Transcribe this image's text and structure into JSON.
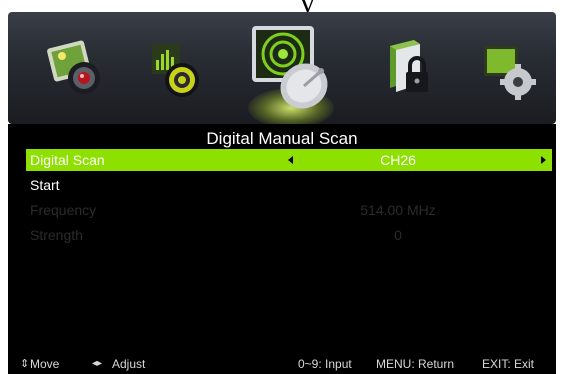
{
  "menu": {
    "title": "Digital Manual Scan",
    "rows": [
      {
        "label": "Digital Scan",
        "value": "CH26",
        "selected": true
      },
      {
        "label": "Start",
        "value": ""
      },
      {
        "label": "Frequency",
        "value": "514.00 MHz",
        "disabled": true
      },
      {
        "label": "Strength",
        "value": "0",
        "disabled": true
      }
    ]
  },
  "top_icons": [
    {
      "name": "picture-icon",
      "selected": false
    },
    {
      "name": "sound-icon",
      "selected": false
    },
    {
      "name": "channel-icon",
      "selected": true
    },
    {
      "name": "lock-icon",
      "selected": false
    },
    {
      "name": "setup-icon",
      "selected": false
    }
  ],
  "footer": {
    "move": "Move",
    "adjust": "Adjust",
    "input": "0~9: Input",
    "return": "MENU: Return",
    "exit": "EXIT: Exit"
  },
  "colors": {
    "selected_row": "#8ee000",
    "background": "#000000",
    "disabled_text": "#2b2b2b"
  }
}
